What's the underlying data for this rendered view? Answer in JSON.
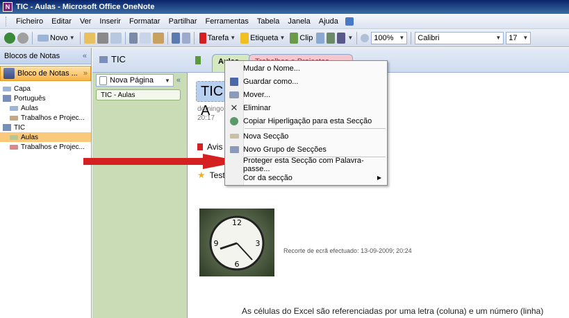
{
  "window": {
    "title": "TIC - Aulas - Microsoft Office OneNote"
  },
  "menu": [
    "Ficheiro",
    "Editar",
    "Ver",
    "Inserir",
    "Formatar",
    "Partilhar",
    "Ferramentas",
    "Tabela",
    "Janela",
    "Ajuda"
  ],
  "toolbar": {
    "new_label": "Novo",
    "task_label": "Tarefa",
    "tag_label": "Etiqueta",
    "clip_label": "Clip",
    "zoom": "100%",
    "font": "Calibri",
    "font_size": "17"
  },
  "left_panel": {
    "header": "Blocos de Notas",
    "collapse": "«",
    "notebook": "Bloco de Notas ...",
    "notebook_arrow": "»",
    "tree": [
      {
        "label": "Capa",
        "type": "section",
        "indent": 1,
        "color": "#9cb4d8"
      },
      {
        "label": "Português",
        "type": "group",
        "indent": 1,
        "color": "#7a8fb8"
      },
      {
        "label": "Aulas",
        "type": "section",
        "indent": 2,
        "color": "#9cb4d8"
      },
      {
        "label": "Trabalhos e Projec...",
        "type": "section",
        "indent": 2,
        "color": "#c8a882"
      },
      {
        "label": "TIC",
        "type": "group",
        "indent": 1,
        "color": "#7a8fb8"
      },
      {
        "label": "Aulas",
        "type": "section",
        "indent": 2,
        "color": "#b4c896",
        "selected": true
      },
      {
        "label": "Trabalhos e Projec...",
        "type": "section",
        "indent": 2,
        "color": "#d88a8a"
      }
    ]
  },
  "section_bar": {
    "group_title": "TIC",
    "active_tab": "Aulas",
    "other_tab": "Trabalhos e Projectos"
  },
  "pages": {
    "new_page": "Nova Página",
    "collapse": "«",
    "items": [
      "TIC - Aulas"
    ]
  },
  "page": {
    "title": "TIC - A",
    "date": "domingo",
    "time": "20:17",
    "tag1": "Avis",
    "tag2": "Test",
    "clip_caption": "Recorte de ecrã efectuado: 13-09-2009; 20:24",
    "body_text": "As células do Excel são referenciadas por uma letra (coluna) e um número (linha)"
  },
  "context_menu": {
    "items": [
      {
        "label": "Mudar o Nome...",
        "icon": "",
        "sep_after": false
      },
      {
        "label": "Guardar como...",
        "icon": "save-icon",
        "sep_after": false
      },
      {
        "label": "Mover...",
        "icon": "move-icon",
        "sep_after": false
      },
      {
        "label": "Eliminar",
        "icon": "delete-icon",
        "sep_after": false
      },
      {
        "label": "Copiar Hiperligação para esta Secção",
        "icon": "link-icon",
        "sep_after": true
      },
      {
        "label": "Nova Secção",
        "icon": "section-icon",
        "sep_after": false
      },
      {
        "label": "Novo Grupo de Secções",
        "icon": "section-group-icon",
        "sep_after": true
      },
      {
        "label": "Proteger esta Secção com Palavra-passe...",
        "icon": "",
        "sep_after": false
      },
      {
        "label": "Cor da secção",
        "icon": "",
        "submenu": true,
        "sep_after": false
      }
    ]
  },
  "colors": {
    "accent_red": "#d42020",
    "selected_section": "#fbc97b",
    "page_column": "#c9dcb6"
  }
}
